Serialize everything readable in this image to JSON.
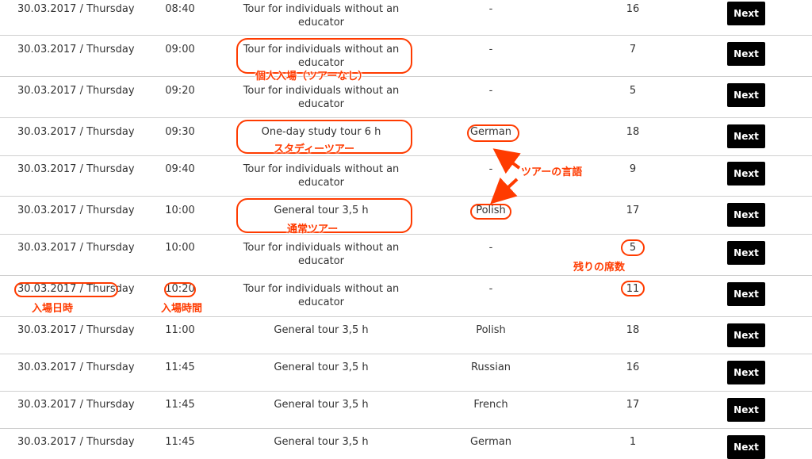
{
  "rows": [
    {
      "date": "30.03.2017 / Thursday",
      "time": "08:40",
      "tour": "Tour for individuals without an educator",
      "language": "-",
      "seats": "16",
      "action": "Next"
    },
    {
      "date": "30.03.2017 / Thursday",
      "time": "09:00",
      "tour": "Tour for individuals without an educator",
      "language": "-",
      "seats": "7",
      "action": "Next"
    },
    {
      "date": "30.03.2017 / Thursday",
      "time": "09:20",
      "tour": "Tour for individuals without an educator",
      "language": "-",
      "seats": "5",
      "action": "Next"
    },
    {
      "date": "30.03.2017 / Thursday",
      "time": "09:30",
      "tour": "One-day study tour 6 h",
      "language": "German",
      "seats": "18",
      "action": "Next"
    },
    {
      "date": "30.03.2017 / Thursday",
      "time": "09:40",
      "tour": "Tour for individuals without an educator",
      "language": "-",
      "seats": "9",
      "action": "Next"
    },
    {
      "date": "30.03.2017 / Thursday",
      "time": "10:00",
      "tour": "General tour 3,5 h",
      "language": "Polish",
      "seats": "17",
      "action": "Next"
    },
    {
      "date": "30.03.2017 / Thursday",
      "time": "10:00",
      "tour": "Tour for individuals without an educator",
      "language": "-",
      "seats": "5",
      "action": "Next"
    },
    {
      "date": "30.03.2017 / Thursday",
      "time": "10:20",
      "tour": "Tour for individuals without an educator",
      "language": "-",
      "seats": "11",
      "action": "Next"
    },
    {
      "date": "30.03.2017 / Thursday",
      "time": "11:00",
      "tour": "General tour 3,5 h",
      "language": "Polish",
      "seats": "18",
      "action": "Next"
    },
    {
      "date": "30.03.2017 / Thursday",
      "time": "11:45",
      "tour": "General tour 3,5 h",
      "language": "Russian",
      "seats": "16",
      "action": "Next"
    },
    {
      "date": "30.03.2017 / Thursday",
      "time": "11:45",
      "tour": "General tour 3,5 h",
      "language": "French",
      "seats": "17",
      "action": "Next"
    },
    {
      "date": "30.03.2017 / Thursday",
      "time": "11:45",
      "tour": "General tour 3,5 h",
      "language": "German",
      "seats": "1",
      "action": "Next"
    }
  ],
  "annotations": {
    "individual_entry": "個人入場（ツアーなし）",
    "study_tour": "スタディーツアー",
    "tour_language": "ツアーの言語",
    "regular_tour": "通常ツアー",
    "remaining_seats": "残りの席数",
    "entry_date": "入場日時",
    "entry_time": "入場時間"
  },
  "colors": {
    "annotation": "#ff3b00",
    "button_bg": "#000000",
    "row_border": "#cfcfcf"
  }
}
